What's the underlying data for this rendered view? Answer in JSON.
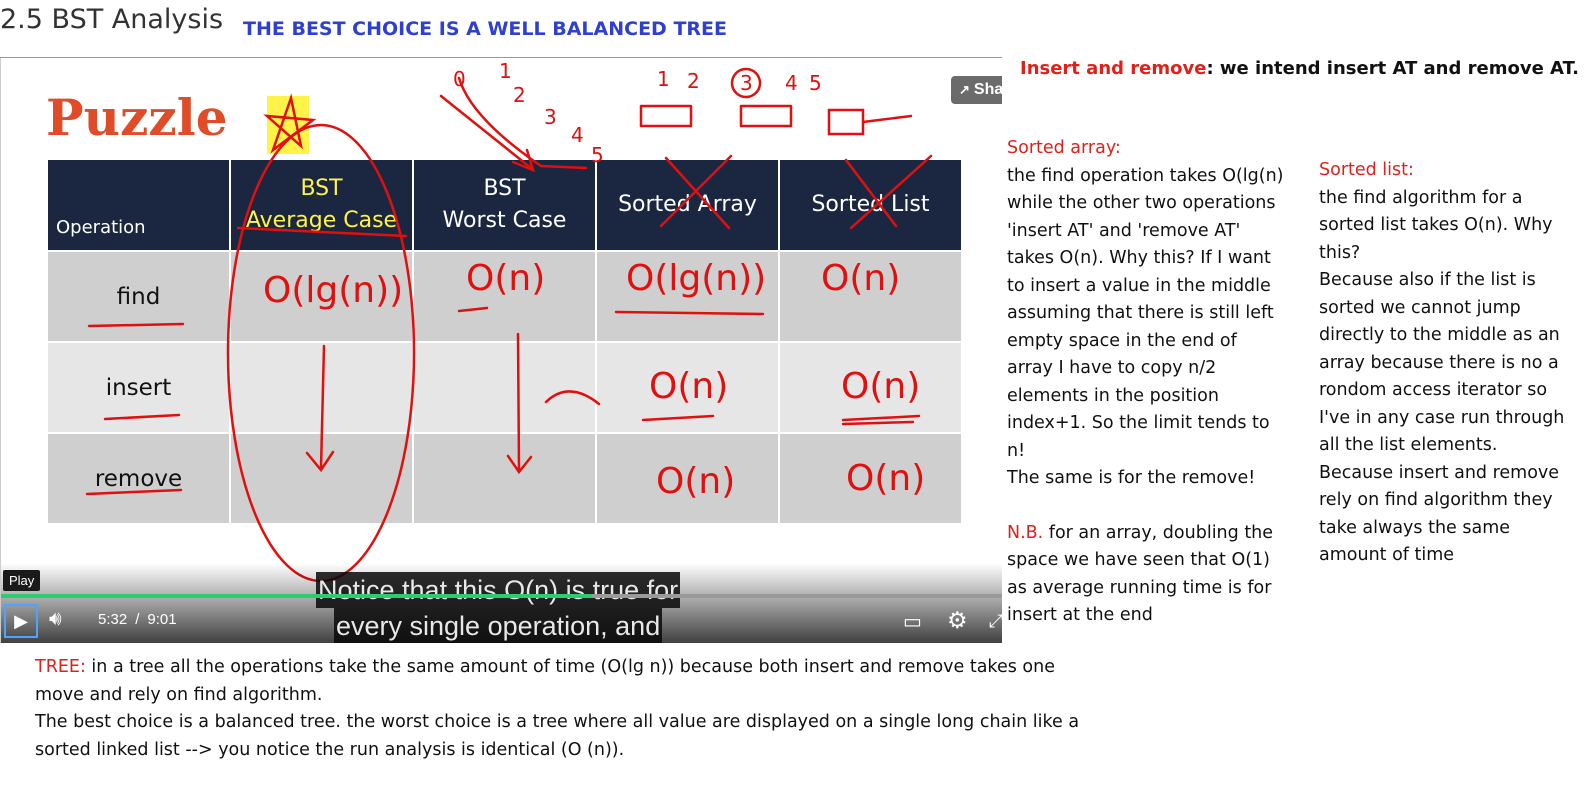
{
  "header": {
    "section_title": "2.5 BST Analysis",
    "banner": "THE BEST CHOICE IS A WELL BALANCED TREE"
  },
  "video": {
    "slide_title": "Puzzle",
    "share_label": "Share",
    "table": {
      "headers": [
        "Operation",
        "BST Average Case",
        "BST Worst Case",
        "Sorted Array",
        "Sorted List"
      ],
      "header_lines": [
        [
          "Operation"
        ],
        [
          "BST",
          "Average Case"
        ],
        [
          "BST",
          "Worst Case"
        ],
        [
          "Sorted Array"
        ],
        [
          "Sorted List"
        ]
      ],
      "rows": [
        "find",
        "insert",
        "remove"
      ]
    },
    "annotations": {
      "complexities": {
        "find": [
          "O(lg(n))",
          "O(n)",
          "O(lg(n))",
          "O(n)"
        ],
        "insert": [
          "",
          "",
          "O(n)",
          "O(n)"
        ],
        "remove": [
          "",
          "",
          "O(n)",
          "O(n)"
        ]
      },
      "sequence_top": [
        "1",
        "2",
        "3",
        "4",
        "5"
      ],
      "diag_numbers": [
        "0",
        "1",
        "2",
        "3",
        "4",
        "5"
      ]
    },
    "controls": {
      "play_tooltip": "Play",
      "current_time": "5:32",
      "separator": "/",
      "duration": "9:01",
      "progress": 0.59,
      "progress_color": "#2ecc71"
    },
    "caption": {
      "line1": "Notice that this O(n) is true for",
      "line2": "every single operation, and"
    }
  },
  "notes": {
    "insert_remove": {
      "label": "Insert and remove",
      "text": ": we intend insert AT and remove AT."
    },
    "sorted_array": {
      "title": "Sorted array:",
      "body": "the find operation takes O(lg(n) while the other two operations 'insert AT' and 'remove AT' takes O(n). Why this? If I want to insert a value in the middle assuming that there is still left empty space in the end of array I have to copy n/2 elements in the position index+1. So the limit tends to n!",
      "body2": "The same is for the remove!",
      "nb_label": "N.B.",
      "nb_text": " for an array, doubling the space we have seen that O(1) as average running time is for insert at the end"
    },
    "sorted_list": {
      "title": "Sorted list:",
      "body": "the find algorithm for a sorted list takes O(n). Why this?",
      "body2": "Because also if the list is sorted we cannot jump directly to the middle as an array because there is no a rondom access iterator so I've in any case run through all the list elements. Because insert and remove rely on find algorithm they take always the same amount of time"
    },
    "tree": {
      "label": "TREE:",
      "text": " in a tree all the operations take the same amount of time (O(lg n)) because both insert and remove takes one move and rely on find algorithm.",
      "text2": "The best choice is a balanced tree. the worst choice is a tree where all value are displayed on a single long chain like a sorted linked list --> you notice the run analysis is identical (O (n))."
    }
  },
  "colors": {
    "banner": "#2f3fd0",
    "note_red": "#e0201a",
    "table_header": "#1b2740",
    "highlight": "#fff34a",
    "ink": "#e0100f"
  }
}
